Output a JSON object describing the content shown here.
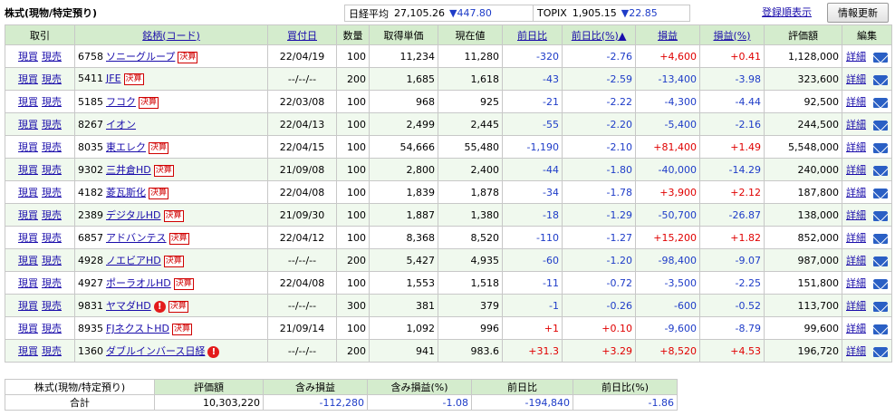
{
  "header": {
    "section_title": "株式(現物/特定預り)",
    "indices": [
      {
        "name": "日経平均",
        "value": "27,105.26",
        "change": "▼447.80"
      },
      {
        "name": "TOPIX",
        "value": "1,905.15",
        "change": "▼22.85"
      }
    ],
    "sort_link": "登録順表示",
    "refresh_button": "情報更新"
  },
  "columns": {
    "trade": "取引",
    "name": "銘柄(コード)",
    "buy_date": "買付日",
    "qty": "数量",
    "cost": "取得単価",
    "price": "現在値",
    "day_chg": "前日比",
    "day_pct": "前日比(%)▲",
    "pl": "損益",
    "pl_pct": "損益(%)",
    "value": "評価額",
    "edit": "編集"
  },
  "labels": {
    "buy": "現買",
    "sell": "現売",
    "detail": "詳細",
    "kessan": "決算",
    "alert": "!"
  },
  "rows": [
    {
      "code": "6758",
      "name": "ソニーグループ",
      "kessan": true,
      "alert": false,
      "date": "22/04/19",
      "qty": "100",
      "cost": "11,234",
      "price": "11,280",
      "chg": "-320",
      "chg_pct": "-2.76",
      "pl": "+4,600",
      "pl_pct": "+0.41",
      "value": "1,128,000"
    },
    {
      "code": "5411",
      "name": "JFE",
      "kessan": true,
      "alert": false,
      "date": "--/--/--",
      "qty": "200",
      "cost": "1,685",
      "price": "1,618",
      "chg": "-43",
      "chg_pct": "-2.59",
      "pl": "-13,400",
      "pl_pct": "-3.98",
      "value": "323,600"
    },
    {
      "code": "5185",
      "name": "フコク",
      "kessan": true,
      "alert": false,
      "date": "22/03/08",
      "qty": "100",
      "cost": "968",
      "price": "925",
      "chg": "-21",
      "chg_pct": "-2.22",
      "pl": "-4,300",
      "pl_pct": "-4.44",
      "value": "92,500"
    },
    {
      "code": "8267",
      "name": "イオン",
      "kessan": false,
      "alert": false,
      "date": "22/04/13",
      "qty": "100",
      "cost": "2,499",
      "price": "2,445",
      "chg": "-55",
      "chg_pct": "-2.20",
      "pl": "-5,400",
      "pl_pct": "-2.16",
      "value": "244,500"
    },
    {
      "code": "8035",
      "name": "東エレク",
      "kessan": true,
      "alert": false,
      "date": "22/04/15",
      "qty": "100",
      "cost": "54,666",
      "price": "55,480",
      "chg": "-1,190",
      "chg_pct": "-2.10",
      "pl": "+81,400",
      "pl_pct": "+1.49",
      "value": "5,548,000"
    },
    {
      "code": "9302",
      "name": "三井倉HD",
      "kessan": true,
      "alert": false,
      "date": "21/09/08",
      "qty": "100",
      "cost": "2,800",
      "price": "2,400",
      "chg": "-44",
      "chg_pct": "-1.80",
      "pl": "-40,000",
      "pl_pct": "-14.29",
      "value": "240,000"
    },
    {
      "code": "4182",
      "name": "菱瓦斯化",
      "kessan": true,
      "alert": false,
      "date": "22/04/08",
      "qty": "100",
      "cost": "1,839",
      "price": "1,878",
      "chg": "-34",
      "chg_pct": "-1.78",
      "pl": "+3,900",
      "pl_pct": "+2.12",
      "value": "187,800"
    },
    {
      "code": "2389",
      "name": "デジタルHD",
      "kessan": true,
      "alert": false,
      "date": "21/09/30",
      "qty": "100",
      "cost": "1,887",
      "price": "1,380",
      "chg": "-18",
      "chg_pct": "-1.29",
      "pl": "-50,700",
      "pl_pct": "-26.87",
      "value": "138,000"
    },
    {
      "code": "6857",
      "name": "アドバンテス",
      "kessan": true,
      "alert": false,
      "date": "22/04/12",
      "qty": "100",
      "cost": "8,368",
      "price": "8,520",
      "chg": "-110",
      "chg_pct": "-1.27",
      "pl": "+15,200",
      "pl_pct": "+1.82",
      "value": "852,000"
    },
    {
      "code": "4928",
      "name": "ノエビアHD",
      "kessan": true,
      "alert": false,
      "date": "--/--/--",
      "qty": "200",
      "cost": "5,427",
      "price": "4,935",
      "chg": "-60",
      "chg_pct": "-1.20",
      "pl": "-98,400",
      "pl_pct": "-9.07",
      "value": "987,000"
    },
    {
      "code": "4927",
      "name": "ポーラオルHD",
      "kessan": true,
      "alert": false,
      "date": "22/04/08",
      "qty": "100",
      "cost": "1,553",
      "price": "1,518",
      "chg": "-11",
      "chg_pct": "-0.72",
      "pl": "-3,500",
      "pl_pct": "-2.25",
      "value": "151,800"
    },
    {
      "code": "9831",
      "name": "ヤマダHD",
      "kessan": true,
      "alert": true,
      "date": "--/--/--",
      "qty": "300",
      "cost": "381",
      "price": "379",
      "chg": "-1",
      "chg_pct": "-0.26",
      "pl": "-600",
      "pl_pct": "-0.52",
      "value": "113,700"
    },
    {
      "code": "8935",
      "name": "FJネクストHD",
      "kessan": true,
      "alert": false,
      "date": "21/09/14",
      "qty": "100",
      "cost": "1,092",
      "price": "996",
      "chg": "+1",
      "chg_pct": "+0.10",
      "pl": "-9,600",
      "pl_pct": "-8.79",
      "value": "99,600"
    },
    {
      "code": "1360",
      "name": "ダブルインバース日経",
      "kessan": false,
      "alert": true,
      "date": "--/--/--",
      "qty": "200",
      "cost": "941",
      "price": "983.6",
      "chg": "+31.3",
      "chg_pct": "+3.29",
      "pl": "+8,520",
      "pl_pct": "+4.53",
      "value": "196,720"
    }
  ],
  "summary": {
    "title": "株式(現物/特定預り)",
    "total_label": "合計",
    "headers": [
      "評価額",
      "含み損益",
      "含み損益(%)",
      "前日比",
      "前日比(%)"
    ],
    "values": [
      "10,303,220",
      "-112,280",
      "-1.08",
      "-194,840",
      "-1.86"
    ]
  },
  "colors": {
    "header_bg": "#d4eccd",
    "row_alt_bg": "#f0f9ee",
    "negative": "#1e3cc8",
    "positive": "#e00000",
    "link": "#1a0dab",
    "badge": "#d00000",
    "mail_icon": "#2a5fc4"
  }
}
